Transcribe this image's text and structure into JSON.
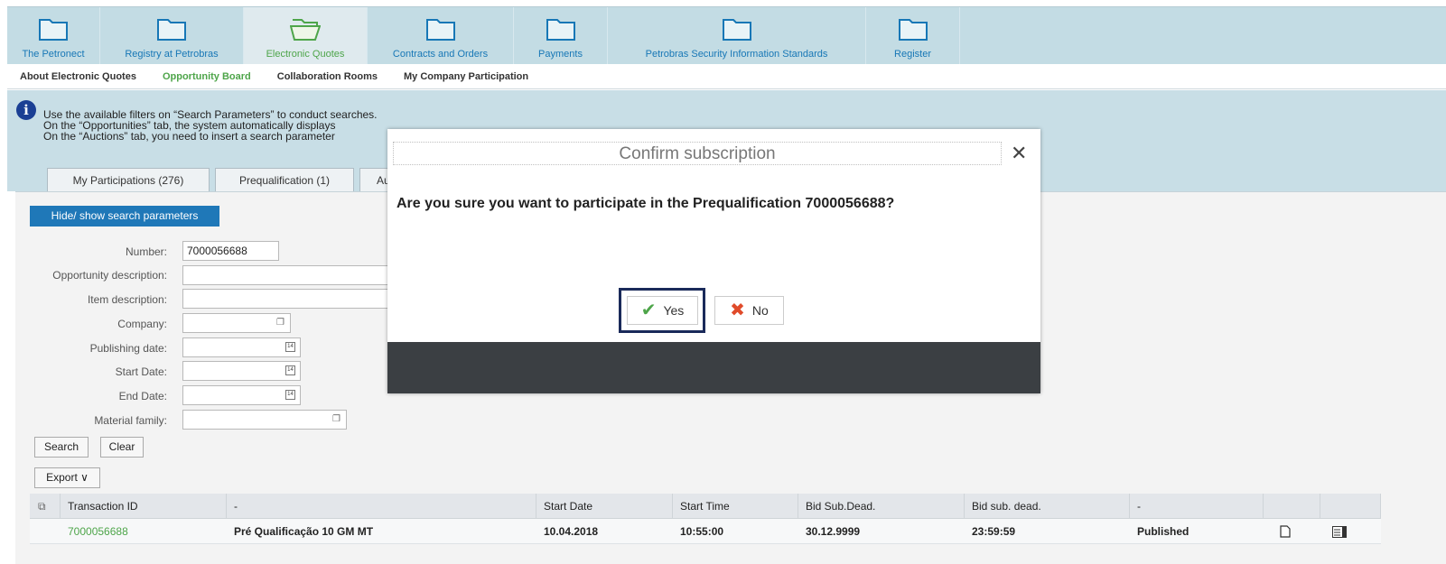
{
  "topnav": {
    "items": [
      {
        "label": "The Petronect",
        "icon": "folder-icon"
      },
      {
        "label": "Registry at Petrobras",
        "icon": "folder-icon"
      },
      {
        "label": "Electronic Quotes",
        "icon": "folder-open-icon",
        "active": true
      },
      {
        "label": "Contracts and Orders",
        "icon": "folder-icon"
      },
      {
        "label": "Payments",
        "icon": "folder-icon"
      },
      {
        "label": "Petrobras Security Information Standards",
        "icon": "folder-icon"
      },
      {
        "label": "Register",
        "icon": "folder-icon"
      }
    ]
  },
  "subnav": {
    "items": [
      {
        "label": "About Electronic Quotes"
      },
      {
        "label": "Opportunity Board",
        "active": true
      },
      {
        "label": "Collaboration Rooms"
      },
      {
        "label": "My Company Participation"
      }
    ]
  },
  "info": {
    "line1": "Use the available filters on “Search Parameters” to conduct searches.",
    "line2": "On the “Opportunities” tab, the system automatically displays",
    "line3": "On the “Auctions” tab, you need to insert a search parameter"
  },
  "tabs": {
    "items": [
      {
        "label": "My Participations (276)"
      },
      {
        "label": "Prequalification (1)"
      },
      {
        "label": "Au"
      }
    ]
  },
  "search": {
    "toggle_label": "Hide/ show search parameters",
    "fields": {
      "number_label": "Number:",
      "number_value": "7000056688",
      "opportunity_label": "Opportunity description:",
      "item_label": "Item description:",
      "company_label": "Company:",
      "publishing_label": "Publishing date:",
      "start_label": "Start Date:",
      "end_label": "End Date:",
      "material_label": "Material family:",
      "calendar_glyph": "14"
    },
    "search_button": "Search",
    "clear_button": "Clear",
    "export_button": "Export ∨"
  },
  "table": {
    "headers": [
      "Transaction ID",
      "-",
      "Start Date",
      "Start Time",
      "Bid Sub.Dead.",
      "Bid sub. dead.",
      "-",
      "",
      ""
    ],
    "rows": [
      [
        "7000056688",
        "Pré Qualificação 10 GM MT",
        "10.04.2018",
        "10:55:00",
        "30.12.9999",
        "23:59:59",
        "Published"
      ]
    ]
  },
  "modal": {
    "title": "Confirm subscription",
    "close": "✕",
    "question": "Are you sure you want to participate in the Prequalification 7000056688?",
    "yes_label": "Yes",
    "no_label": "No"
  },
  "colors": {
    "nav_bg": "#c3dce4",
    "link_blue": "#1777b6",
    "active_green": "#4ea54a",
    "button_blue": "#1f78b8",
    "info_icon": "#1b3f94",
    "modal_dark": "#3b3f43",
    "yes_frame": "#1a2a5a"
  }
}
